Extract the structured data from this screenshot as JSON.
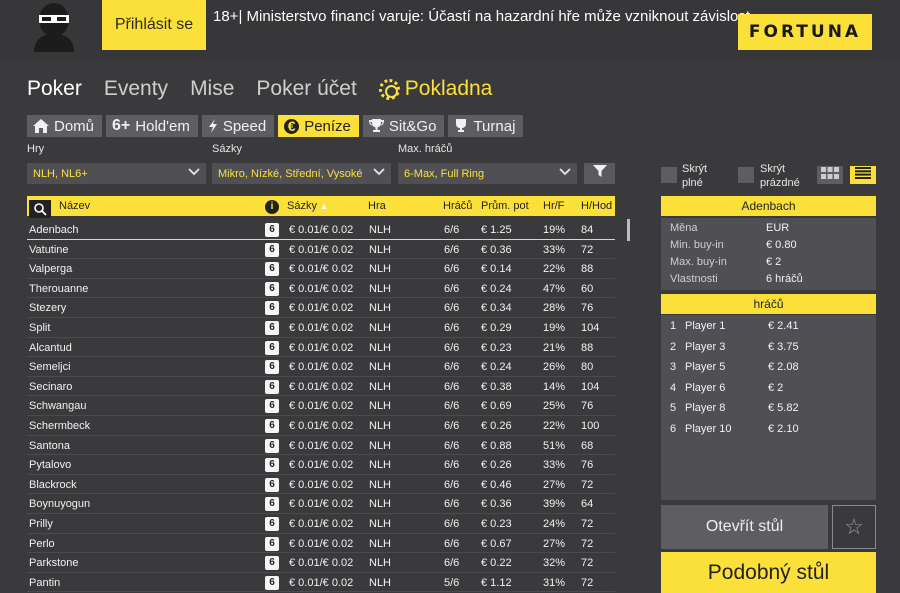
{
  "header": {
    "login_label": "Přihlásit se",
    "warning": "18+| Ministerstvo financí varuje: Účastí na hazardní hře může vzniknout závislost.",
    "brand": "FORTUNA"
  },
  "nav": {
    "items": [
      "Poker",
      "Eventy",
      "Mise",
      "Poker účet"
    ],
    "active": "Pokladna"
  },
  "tabs": [
    {
      "label": "Domů",
      "icon": "home-icon"
    },
    {
      "label": "Hold'em",
      "icon": "six-plus-icon",
      "icon_text": "6+"
    },
    {
      "label": "Speed",
      "icon": "lightning-icon"
    },
    {
      "label": "Peníze",
      "icon": "euro-coin-icon",
      "icon_text": "€"
    },
    {
      "label": "Sit&Go",
      "icon": "trophy-icon"
    },
    {
      "label": "Turnaj",
      "icon": "cup-icon"
    }
  ],
  "filters": {
    "games_label": "Hry",
    "games_value": "NLH, NL6+",
    "stakes_label": "Sázky",
    "stakes_value": "Mikro, Nízké, Střední, Vysoké",
    "players_label": "Max. hráčů",
    "players_value": "6-Max, Full Ring"
  },
  "table": {
    "headers": {
      "name": "Název",
      "stakes": "Sázky",
      "game": "Hra",
      "players": "Hráčů",
      "avg_pot": "Prům. pot",
      "hf": "Hr/F",
      "hh": "H/Hod"
    },
    "rows": [
      {
        "name": "Adenbach",
        "seat": "6",
        "stakes": "€ 0.01/€ 0.02",
        "game": "NLH",
        "players": "6/6",
        "pot": "€ 1.25",
        "hf": "19%",
        "hh": "84"
      },
      {
        "name": "Vatutine",
        "seat": "6",
        "stakes": "€ 0.01/€ 0.02",
        "game": "NLH",
        "players": "6/6",
        "pot": "€ 0.36",
        "hf": "33%",
        "hh": "72"
      },
      {
        "name": "Valperga",
        "seat": "6",
        "stakes": "€ 0.01/€ 0.02",
        "game": "NLH",
        "players": "6/6",
        "pot": "€ 0.14",
        "hf": "22%",
        "hh": "88"
      },
      {
        "name": "Therouanne",
        "seat": "6",
        "stakes": "€ 0.01/€ 0.02",
        "game": "NLH",
        "players": "6/6",
        "pot": "€ 0.24",
        "hf": "47%",
        "hh": "60"
      },
      {
        "name": "Stezery",
        "seat": "6",
        "stakes": "€ 0.01/€ 0.02",
        "game": "NLH",
        "players": "6/6",
        "pot": "€ 0.34",
        "hf": "28%",
        "hh": "76"
      },
      {
        "name": "Split",
        "seat": "6",
        "stakes": "€ 0.01/€ 0.02",
        "game": "NLH",
        "players": "6/6",
        "pot": "€ 0.29",
        "hf": "19%",
        "hh": "104"
      },
      {
        "name": "Alcantud",
        "seat": "6",
        "stakes": "€ 0.01/€ 0.02",
        "game": "NLH",
        "players": "6/6",
        "pot": "€ 0.23",
        "hf": "21%",
        "hh": "88"
      },
      {
        "name": "Semeljci",
        "seat": "6",
        "stakes": "€ 0.01/€ 0.02",
        "game": "NLH",
        "players": "6/6",
        "pot": "€ 0.24",
        "hf": "26%",
        "hh": "80"
      },
      {
        "name": "Secinaro",
        "seat": "6",
        "stakes": "€ 0.01/€ 0.02",
        "game": "NLH",
        "players": "6/6",
        "pot": "€ 0.38",
        "hf": "14%",
        "hh": "104"
      },
      {
        "name": "Schwangau",
        "seat": "6",
        "stakes": "€ 0.01/€ 0.02",
        "game": "NLH",
        "players": "6/6",
        "pot": "€ 0.69",
        "hf": "25%",
        "hh": "76"
      },
      {
        "name": "Schermbeck",
        "seat": "6",
        "stakes": "€ 0.01/€ 0.02",
        "game": "NLH",
        "players": "6/6",
        "pot": "€ 0.26",
        "hf": "22%",
        "hh": "100"
      },
      {
        "name": "Santona",
        "seat": "6",
        "stakes": "€ 0.01/€ 0.02",
        "game": "NLH",
        "players": "6/6",
        "pot": "€ 0.88",
        "hf": "51%",
        "hh": "68"
      },
      {
        "name": "Pytalovo",
        "seat": "6",
        "stakes": "€ 0.01/€ 0.02",
        "game": "NLH",
        "players": "6/6",
        "pot": "€ 0.26",
        "hf": "33%",
        "hh": "76"
      },
      {
        "name": "Blackrock",
        "seat": "6",
        "stakes": "€ 0.01/€ 0.02",
        "game": "NLH",
        "players": "6/6",
        "pot": "€ 0.46",
        "hf": "27%",
        "hh": "72"
      },
      {
        "name": "Boynuyogun",
        "seat": "6",
        "stakes": "€ 0.01/€ 0.02",
        "game": "NLH",
        "players": "6/6",
        "pot": "€ 0.36",
        "hf": "39%",
        "hh": "64"
      },
      {
        "name": "Prilly",
        "seat": "6",
        "stakes": "€ 0.01/€ 0.02",
        "game": "NLH",
        "players": "6/6",
        "pot": "€ 0.23",
        "hf": "24%",
        "hh": "72"
      },
      {
        "name": "Perlo",
        "seat": "6",
        "stakes": "€ 0.01/€ 0.02",
        "game": "NLH",
        "players": "6/6",
        "pot": "€ 0.67",
        "hf": "27%",
        "hh": "72"
      },
      {
        "name": "Parkstone",
        "seat": "6",
        "stakes": "€ 0.01/€ 0.02",
        "game": "NLH",
        "players": "6/6",
        "pot": "€ 0.22",
        "hf": "32%",
        "hh": "72"
      },
      {
        "name": "Pantin",
        "seat": "6",
        "stakes": "€ 0.01/€ 0.02",
        "game": "NLH",
        "players": "5/6",
        "pot": "€ 1.12",
        "hf": "31%",
        "hh": "72"
      }
    ]
  },
  "side": {
    "hide_full": "Skrýt\nplné",
    "hide_empty": "Skrýt\nprázdné",
    "details_title": "Adenbach",
    "details": [
      {
        "k": "Měna",
        "v": "EUR"
      },
      {
        "k": "Min. buy-in",
        "v": "€ 0.80"
      },
      {
        "k": "Max. buy-in",
        "v": "€ 2"
      },
      {
        "k": "Vlastnosti",
        "v": "6 hráčů"
      }
    ],
    "players_title": "hráčů",
    "players": [
      {
        "n": "1",
        "name": "Player 1",
        "amt": "€ 2.41"
      },
      {
        "n": "2",
        "name": "Player 3",
        "amt": "€ 3.75"
      },
      {
        "n": "3",
        "name": "Player 5",
        "amt": "€ 2.08"
      },
      {
        "n": "4",
        "name": "Player 6",
        "amt": "€ 2"
      },
      {
        "n": "5",
        "name": "Player 8",
        "amt": "€ 5.82"
      },
      {
        "n": "6",
        "name": "Player 10",
        "amt": "€ 2.10"
      }
    ],
    "open_label": "Otevřít stůl",
    "similar_label": "Podobný stůl"
  }
}
